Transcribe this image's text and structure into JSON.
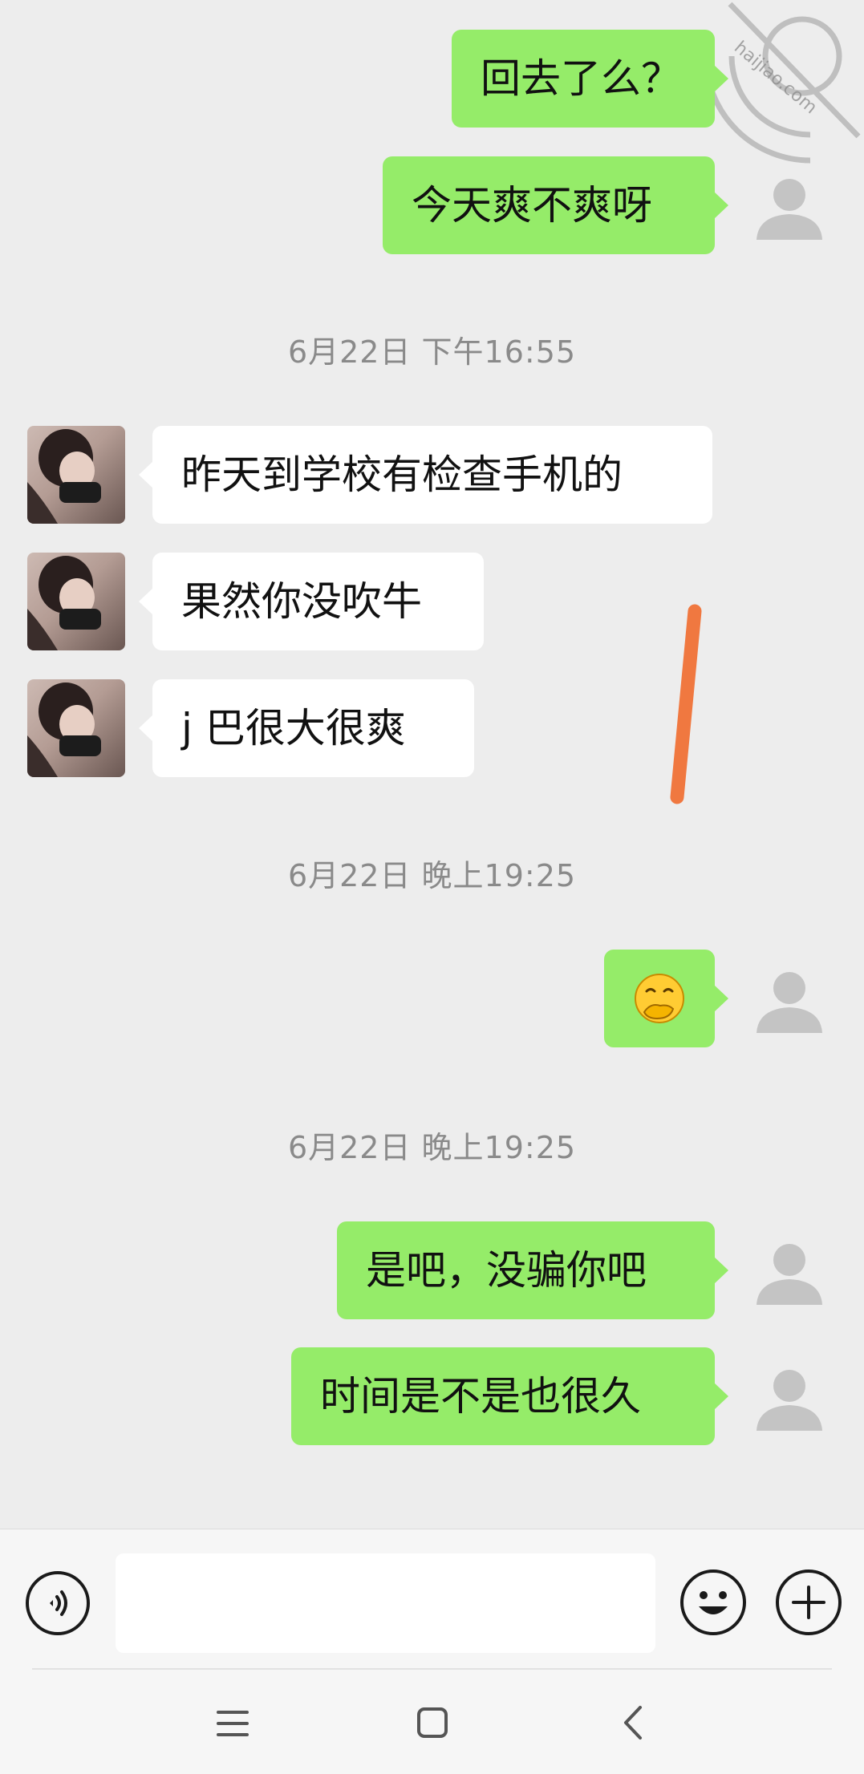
{
  "messages": [
    {
      "side": "out",
      "text": "回去了么？"
    },
    {
      "side": "out",
      "text": "今天爽不爽呀"
    },
    {
      "side": "in",
      "text": "昨天到学校有检查手机的"
    },
    {
      "side": "in",
      "text": "果然你没吹牛"
    },
    {
      "side": "in",
      "text": "j 巴很大很爽"
    },
    {
      "side": "out",
      "emoji": "smile-with-hand-over-mouth"
    },
    {
      "side": "out",
      "text": "是吧，没骗你吧"
    },
    {
      "side": "out",
      "text": "时间是不是也很久"
    }
  ],
  "timestamps": [
    "6月22日 下午16:55",
    "6月22日 晚上19:25",
    "6月22日 晚上19:25"
  ],
  "watermark": "haijiao.com",
  "bottom_bar": {
    "voice_icon": "voice-wave-icon",
    "emoji_icon": "smiley-icon",
    "plus_icon": "plus-icon",
    "nav_icons": [
      "menu-icon",
      "home-square-icon",
      "back-chevron-icon"
    ]
  },
  "colors": {
    "out_bubble": "#95ec69",
    "in_bubble": "#ffffff",
    "background": "#ededed",
    "annotation_stroke": "#f07840"
  }
}
